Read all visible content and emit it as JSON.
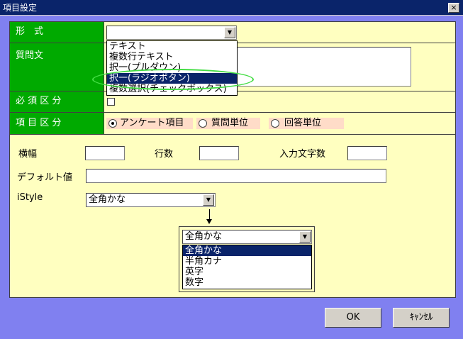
{
  "window": {
    "title": "項目設定",
    "close_label": "×"
  },
  "format": {
    "label": "形　式",
    "selected": "",
    "options": [
      "テキスト",
      "複数行テキスト",
      "択一(プルダウン)",
      "択一(ラジオボタン)",
      "複数選択(チェックボックス)"
    ],
    "highlighted_index": 3
  },
  "question": {
    "label": "質問文",
    "value": ""
  },
  "required": {
    "label": "必 須 区 分"
  },
  "item_type": {
    "label": "項 目 区 分",
    "options": [
      "アンケート項目",
      "質問単位",
      "回答単位"
    ],
    "selected_index": 0
  },
  "fields": {
    "width_label": "横幅",
    "rows_label": "行数",
    "chars_label": "入力文字数",
    "default_label": "デフォルト値",
    "istyle_label": "iStyle",
    "istyle_selected": "全角かな"
  },
  "istyle_popup": {
    "selected": "全角かな",
    "options": [
      "全角かな",
      "半角カナ",
      "英字",
      "数字"
    ],
    "highlighted_index": 0
  },
  "buttons": {
    "ok": "OK",
    "cancel": "ｷｬﾝｾﾙ"
  },
  "colors": {
    "background": "#8080f0",
    "panel": "#ffffc0",
    "label_green": "#00aa00",
    "titlebar": "#0a246a",
    "highlight_ring": "#44dd44"
  }
}
